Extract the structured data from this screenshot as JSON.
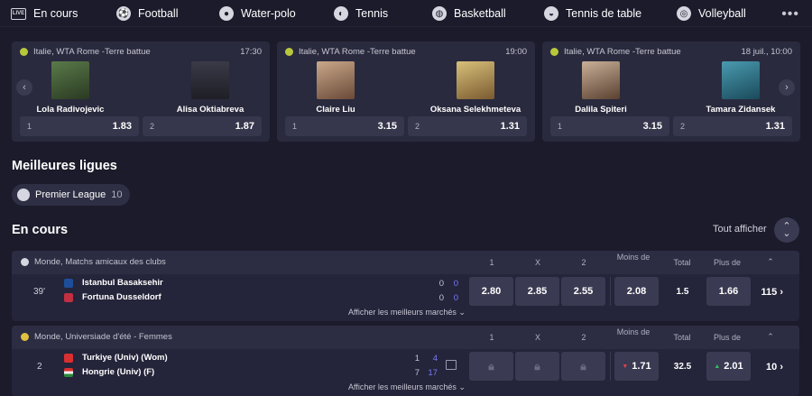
{
  "nav": {
    "items": [
      {
        "label": "En cours",
        "icon": "live-icon"
      },
      {
        "label": "Football",
        "icon": "football-icon"
      },
      {
        "label": "Water-polo",
        "icon": "water-polo-icon"
      },
      {
        "label": "Tennis",
        "icon": "tennis-icon"
      },
      {
        "label": "Basketball",
        "icon": "basketball-icon"
      },
      {
        "label": "Tennis de table",
        "icon": "table-tennis-icon"
      },
      {
        "label": "Volleyball",
        "icon": "volleyball-icon"
      }
    ],
    "more": "•••"
  },
  "cards": [
    {
      "league": "Italie, WTA Rome -Terre battue",
      "time": "17:30",
      "p1": "Lola Radivojevic",
      "p2": "Alisa Oktiabreva",
      "o1k": "1",
      "o1v": "1.83",
      "o2k": "2",
      "o2v": "1.87"
    },
    {
      "league": "Italie, WTA Rome -Terre battue",
      "time": "19:00",
      "p1": "Claire Liu",
      "p2": "Oksana Selekhmeteva",
      "o1k": "1",
      "o1v": "3.15",
      "o2k": "2",
      "o2v": "1.31"
    },
    {
      "league": "Italie, WTA Rome -Terre battue",
      "time": "18 juil., 10:00",
      "p1": "Dalila Spiteri",
      "p2": "Tamara Zidansek",
      "o1k": "1",
      "o1v": "3.15",
      "o2k": "2",
      "o2v": "1.31"
    }
  ],
  "top_leagues": {
    "title": "Meilleures ligues",
    "chip": {
      "name": "Premier League",
      "count": "10"
    }
  },
  "live": {
    "title": "En cours",
    "show_all": "Tout afficher",
    "columns": {
      "c1": "1",
      "cx": "X",
      "c2": "2",
      "under": "Moins de",
      "total": "Total",
      "over": "Plus de"
    },
    "best_markets": "Afficher les meilleurs marchés",
    "events": [
      {
        "league": "Monde, Matchs amicaux des clubs",
        "clock": "39'",
        "home": "Istanbul Basaksehir",
        "away": "Fortuna Dusseldorf",
        "home_score_a": "0",
        "home_score_b": "0",
        "away_score_a": "0",
        "away_score_b": "0",
        "odd1": "2.80",
        "oddx": "2.85",
        "odd2": "2.55",
        "under": "2.08",
        "total": "1.5",
        "over": "1.66",
        "markets": "115"
      },
      {
        "league": "Monde, Universiade d'été - Femmes",
        "clock": "2",
        "home": "Turkiye (Univ) (Wom)",
        "away": "Hongrie (Univ) (F)",
        "home_score_a": "1",
        "home_score_b": "4",
        "away_score_a": "7",
        "away_score_b": "17",
        "under": "1.71",
        "total": "32.5",
        "over": "2.01",
        "markets": "10"
      }
    ]
  }
}
